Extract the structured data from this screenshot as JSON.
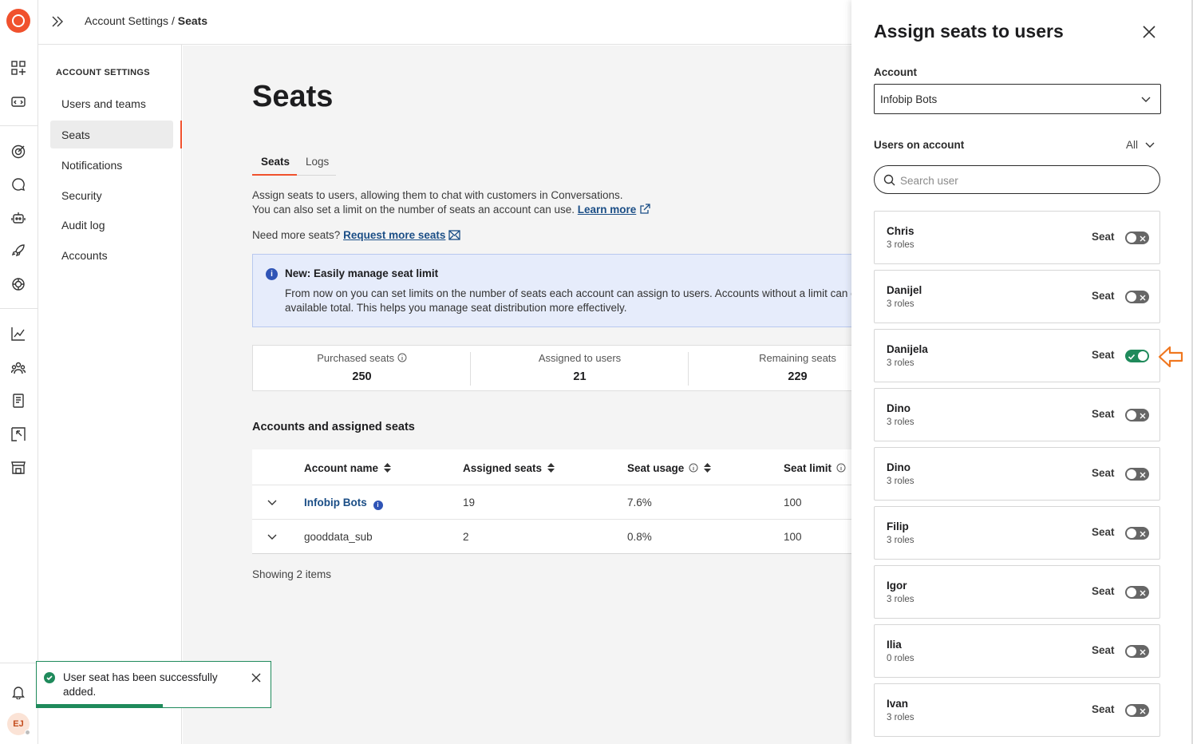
{
  "rail": {
    "icons": [
      "logo-icon",
      "apps-icon",
      "dev-tools-icon",
      "target-icon",
      "chat-icon",
      "bot-icon",
      "rocket-icon",
      "ai-icon",
      "analytics-icon",
      "people-icon",
      "docs-icon",
      "integrations-icon",
      "store-icon",
      "bell-icon"
    ],
    "avatar": "EJ"
  },
  "topbar": {
    "breadcrumb_parent": "Account Settings /",
    "breadcrumb_current": "Seats"
  },
  "subnav": {
    "heading": "ACCOUNT SETTINGS",
    "items": [
      {
        "label": "Users and teams"
      },
      {
        "label": "Seats"
      },
      {
        "label": "Notifications"
      },
      {
        "label": "Security"
      },
      {
        "label": "Audit log"
      },
      {
        "label": "Accounts"
      }
    ]
  },
  "main": {
    "title": "Seats",
    "tabs": [
      {
        "label": "Seats"
      },
      {
        "label": "Logs"
      }
    ],
    "desc_line1": "Assign seats to users, allowing them to chat with customers in Conversations.",
    "desc_line2": "You can also set a limit on the number of seats an account can use.",
    "learn_more": "Learn more",
    "need_more": "Need more seats?",
    "request_more": "Request more seats",
    "banner": {
      "title": "New: Easily manage seat limit",
      "body": "From now on you can set limits on the number of seats each account can assign to users. Accounts without a limit can c",
      "body2": "available total. This helps you manage seat distribution more effectively."
    },
    "stats": [
      {
        "label": "Purchased seats",
        "value": "250"
      },
      {
        "label": "Assigned to users",
        "value": "21"
      },
      {
        "label": "Remaining seats",
        "value": "229"
      }
    ],
    "section_title": "Accounts and assigned seats",
    "table": {
      "columns": [
        "Account name",
        "Assigned seats",
        "Seat usage",
        "Seat limit"
      ],
      "rows": [
        {
          "account": "Infobip Bots",
          "assigned": "19",
          "usage": "7.6%",
          "limit": "100"
        },
        {
          "account": "gooddata_sub",
          "assigned": "2",
          "usage": "0.8%",
          "limit": "100"
        }
      ]
    },
    "showing": "Showing 2 items"
  },
  "toast": {
    "message": "User seat has been successfully added.",
    "progress": 0.54,
    "color": "#1f8a5b"
  },
  "panel": {
    "title": "Assign seats to users",
    "account_label": "Account",
    "account_value": "Infobip Bots",
    "users_label": "Users on account",
    "filter_value": "All",
    "search_placeholder": "Search user",
    "seat_label": "Seat",
    "users": [
      {
        "name": "Chris",
        "roles": "3 roles",
        "seat": false
      },
      {
        "name": "Danijel",
        "roles": "3 roles",
        "seat": false
      },
      {
        "name": "Danijela",
        "roles": "3 roles",
        "seat": true
      },
      {
        "name": "Dino",
        "roles": "3 roles",
        "seat": false
      },
      {
        "name": "Dino",
        "roles": "3 roles",
        "seat": false
      },
      {
        "name": "Filip",
        "roles": "3 roles",
        "seat": false
      },
      {
        "name": "Igor",
        "roles": "3 roles",
        "seat": false
      },
      {
        "name": "Ilia",
        "roles": "0 roles",
        "seat": false
      },
      {
        "name": "Ivan",
        "roles": "3 roles",
        "seat": false
      }
    ]
  },
  "colors": {
    "accent": "#f0512d",
    "link": "#1b4e86",
    "success": "#1f8a5b",
    "banner_bg": "#e6ecfb"
  }
}
